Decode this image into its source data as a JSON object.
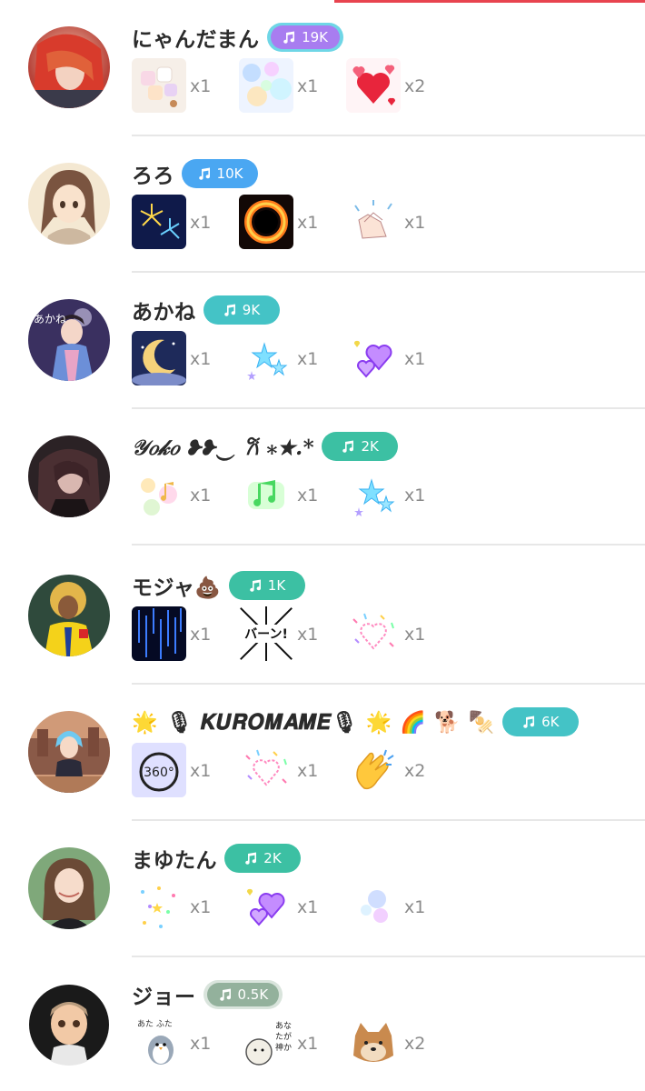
{
  "theme": {
    "accent_red": "#e8434f",
    "badge_purple": "#a87df0",
    "badge_purple_ring": "#6fd6e6",
    "badge_blue": "#4aa7f2",
    "badge_teal": "#44c3c6",
    "badge_green": "#3cc0a3",
    "badge_gray": "#93b19c"
  },
  "users": [
    {
      "name": "にゃんだまん",
      "badge": "19K",
      "badge_color": "purple",
      "avatar": "red-hair-portrait",
      "gifts": [
        {
          "icon": "marshmallow-gift-icon",
          "count": "x1"
        },
        {
          "icon": "bubbles-gift-icon",
          "count": "x1"
        },
        {
          "icon": "hearts-gift-icon",
          "count": "x2"
        }
      ]
    },
    {
      "name": "ろろ",
      "badge": "10K",
      "badge_color": "blue",
      "avatar": "anime-girl-portrait",
      "gifts": [
        {
          "icon": "fireworks-gift-icon",
          "count": "x1"
        },
        {
          "icon": "fire-ring-gift-icon",
          "count": "x1"
        },
        {
          "icon": "clapping-gift-icon",
          "count": "x1"
        }
      ]
    },
    {
      "name": "あかね",
      "badge": "9K",
      "badge_color": "teal",
      "avatar": "kimono-portrait",
      "gifts": [
        {
          "icon": "moon-gift-icon",
          "count": "x1"
        },
        {
          "icon": "blue-stars-gift-icon",
          "count": "x1"
        },
        {
          "icon": "purple-hearts-gift-icon",
          "count": "x1"
        }
      ]
    },
    {
      "name": "𝒴𝑜𝓀𝑜 ❥❥︎︎‿ 𐙚 ⁎★.*",
      "badge": "2K",
      "badge_color": "green",
      "script": true,
      "avatar": "dark-anime-portrait",
      "gifts": [
        {
          "icon": "pastel-notes-gift-icon",
          "count": "x1"
        },
        {
          "icon": "green-notes-gift-icon",
          "count": "x1"
        },
        {
          "icon": "blue-stars-gift-icon",
          "count": "x1"
        }
      ]
    },
    {
      "name": "モジャ💩",
      "badge": "1K",
      "badge_color": "green",
      "avatar": "soccer-player-portrait",
      "gifts": [
        {
          "icon": "blue-rain-gift-icon",
          "count": "x1"
        },
        {
          "icon": "baan-manga-gift-icon",
          "count": "x1"
        },
        {
          "icon": "confetti-heart-gift-icon",
          "count": "x1"
        }
      ]
    },
    {
      "name": "🌟 🎙 𝑲𝑼𝑹𝑶𝑴𝑨𝑴𝑬🎙 🌟 🌈 🐕 🍢",
      "badge": "6K",
      "badge_color": "teal",
      "avatar": "castle-anime-portrait",
      "gifts": [
        {
          "icon": "spin-360-gift-icon",
          "count": "x1"
        },
        {
          "icon": "confetti-heart-gift-icon",
          "count": "x1"
        },
        {
          "icon": "clapping-hands-gift-icon",
          "count": "x2"
        }
      ]
    },
    {
      "name": "まゆたん",
      "badge": "2K",
      "badge_color": "green",
      "avatar": "smiling-woman-portrait",
      "gifts": [
        {
          "icon": "sparkle-confetti-gift-icon",
          "count": "x1"
        },
        {
          "icon": "purple-hearts-gift-icon",
          "count": "x1"
        },
        {
          "icon": "pastel-bubbles-gift-icon",
          "count": "x1"
        }
      ]
    },
    {
      "name": "ジョー",
      "badge": "0.5K",
      "badge_color": "gray",
      "avatar": "cartoon-man-portrait",
      "gifts": [
        {
          "icon": "penguin-sticker-gift-icon",
          "count": "x1",
          "label": "あた ふた"
        },
        {
          "icon": "sheep-sticker-gift-icon",
          "count": "x1",
          "label": "あなたが神か…"
        },
        {
          "icon": "shiba-sticker-gift-icon",
          "count": "x2"
        }
      ]
    }
  ]
}
